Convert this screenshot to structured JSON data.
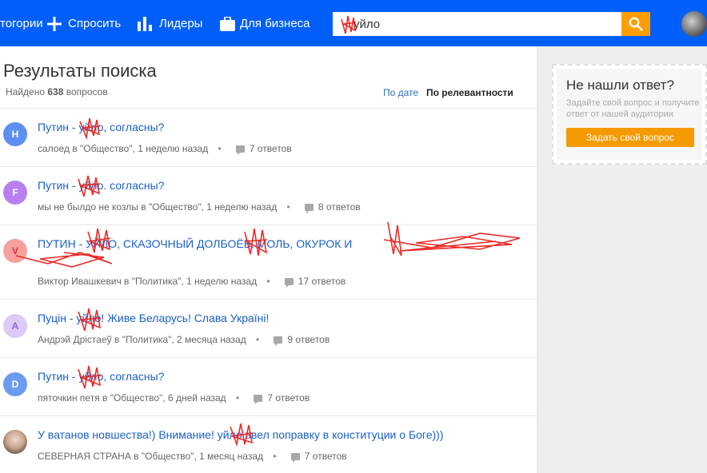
{
  "header": {
    "nav": [
      {
        "label": "тогории",
        "icon": "categories-icon"
      },
      {
        "label": "Спросить",
        "icon": "plus-icon"
      },
      {
        "label": "Лидеры",
        "icon": "leaders-chart-icon"
      },
      {
        "label": "Для бизнеса",
        "icon": "briefcase-icon"
      }
    ],
    "search_value": "уйло",
    "search_icon": "search-icon",
    "colors": {
      "bar": "#005ff9",
      "search_button": "#ff9e00"
    }
  },
  "main": {
    "title": "Результаты поиска",
    "found_prefix": "Найдено",
    "found_count": "638",
    "found_suffix": "вопросов",
    "sort_date": "По дате",
    "sort_relevance": "По релевантности"
  },
  "questions": [
    {
      "avatar_letter": "Н",
      "avatar_color": "#5c8ff0",
      "title": "Путин - уйло, согласны?",
      "author": "салоед",
      "in": "в",
      "category": "\"Общество\"",
      "time": ", 1 неделю назад",
      "answers": "7 ответов"
    },
    {
      "avatar_letter": "F",
      "avatar_color": "#b77ff0",
      "title": "Путин - уйло. согласны?",
      "author": "мы не былдо не козлы",
      "in": "в",
      "category": "\"Общество\"",
      "time": ", 1 неделю назад",
      "answers": "8 ответов"
    },
    {
      "avatar_letter": "V",
      "avatar_color": "#f7a0a0",
      "title": "ПУТИН - УЙЛО, СКАЗОЧНЫЙ ДОЛБОЁБ, МОЛЬ, ОКУРОК И",
      "author": "Виктор Ивашкевич",
      "in": "в",
      "category": "\"Политика\"",
      "time": ", 1 неделю назад",
      "answers": "17 ответов"
    },
    {
      "avatar_letter": "А",
      "avatar_color": "#d8c4f5",
      "title": "Пуцін - уйло! Живе Беларусь! Слава Україні!",
      "author": "Андрэй Дрістаеў",
      "in": "в",
      "category": "\"Политика\"",
      "time": ", 2 месяца назад",
      "answers": "9 ответов"
    },
    {
      "avatar_letter": "D",
      "avatar_color": "#6b9cf0",
      "title": "Путин - уйло, согласны?",
      "author": "пяточкин петя",
      "in": "в",
      "category": "\"Общество\"",
      "time": ", 6 дней назад",
      "answers": "7 ответов"
    },
    {
      "avatar_letter": "",
      "avatar_color": "#c9b9ad",
      "title": "У ватанов новшества!) Внимание! уйло ввел поправку в конституции о Боге)))",
      "author": "СЕВЕРНАЯ СТРАНА",
      "in": "в",
      "category": "\"Общество\"",
      "time": ", 1 месяц назад",
      "answers": "7 ответов"
    }
  ],
  "sidebar": {
    "title": "Не нашли ответ?",
    "desc1": "Задайте свой вопрос и получите",
    "desc2": "ответ от нашей аудитории",
    "button": "Задать свой вопрос",
    "button_color": "#f59a00"
  }
}
